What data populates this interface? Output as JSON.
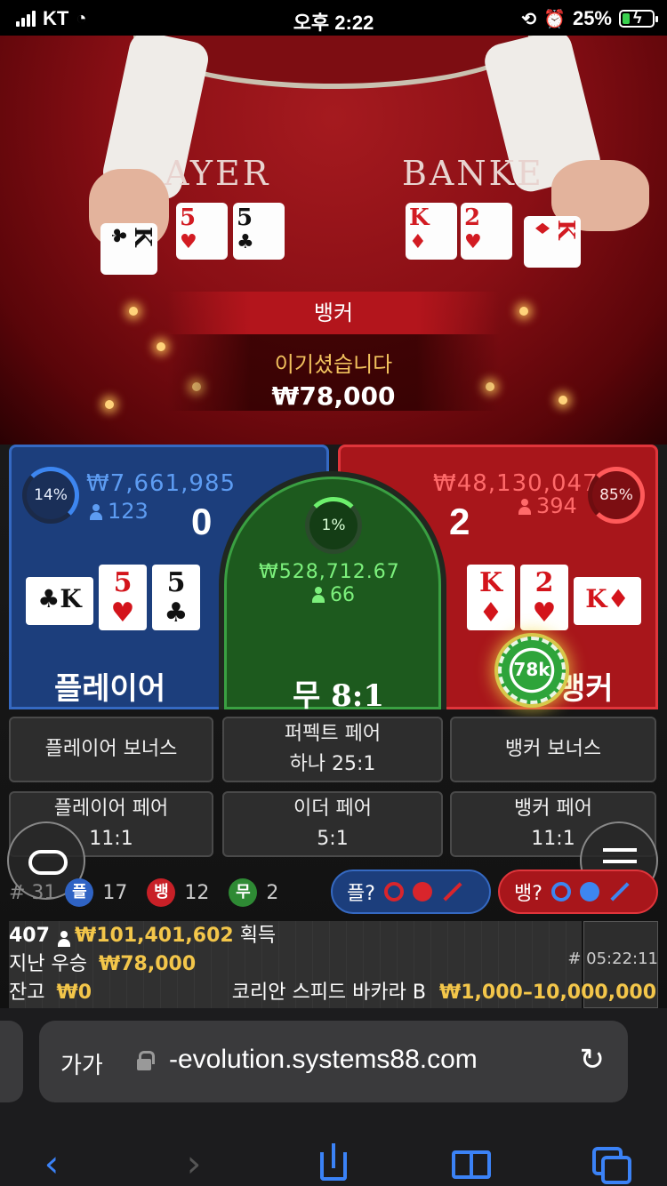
{
  "status_bar": {
    "carrier": "KT",
    "time": "오후 2:22",
    "battery": "25%"
  },
  "video": {
    "player_table_text": "AYER",
    "banker_table_text": "BANKE",
    "result_label": "뱅커",
    "win_message": "이기셨습니다",
    "win_amount": "₩78,000",
    "player_cards": [
      "K",
      "5",
      "5"
    ],
    "banker_cards": [
      "K",
      "2",
      "K"
    ]
  },
  "player": {
    "percent": "14%",
    "bet_total": "₩7,661,985",
    "players": "123",
    "score": "0",
    "label": "플레이어",
    "cards": [
      {
        "rank": "K",
        "suit": "♣",
        "color": "#111111"
      },
      {
        "rank": "5",
        "suit": "♥",
        "color": "#d3141b"
      },
      {
        "rank": "5",
        "suit": "♣",
        "color": "#111111"
      }
    ]
  },
  "tie": {
    "percent": "1%",
    "bet_total": "₩528,712.67",
    "players": "66",
    "label": "무",
    "payout": "8:1"
  },
  "banker": {
    "percent": "85%",
    "bet_total": "₩48,130,047",
    "players": "394",
    "score": "2",
    "label": "뱅커",
    "chip": "78k",
    "cards": [
      {
        "rank": "K",
        "suit": "♦",
        "color": "#d3141b"
      },
      {
        "rank": "2",
        "suit": "♥",
        "color": "#d3141b"
      },
      {
        "rank": "K",
        "suit": "♦",
        "color": "#d3141b"
      }
    ]
  },
  "side_bets": {
    "player_bonus": "플레이어 보너스",
    "perfect_pair": "퍼펙트 페어",
    "perfect_pair_payout": "하나 25:1",
    "banker_bonus": "뱅커 보너스",
    "player_pair": "플레이어 페어",
    "player_pair_payout": "11:1",
    "either_pair": "이더 페어",
    "either_pair_payout": "5:1",
    "banker_pair": "뱅커 페어",
    "banker_pair_payout": "11:1"
  },
  "stats": {
    "round_hash": "# 31",
    "player_badge": "플",
    "player_count": "17",
    "banker_badge": "뱅",
    "banker_count": "12",
    "tie_badge": "무",
    "tie_count": "2",
    "player_predict": "플?",
    "banker_predict": "뱅?"
  },
  "info": {
    "winners": "407",
    "total_won": "₩101,401,602",
    "won_label": "획득",
    "last_win_label": "지난 우승",
    "last_win": "₩78,000",
    "balance_label": "잔고",
    "balance": "₩0",
    "table_name": "코리안 스피드 바카라 B",
    "limits": "₩1,000–10,000,000",
    "game_id": "# 05:22:11"
  },
  "browser": {
    "aa": "가가",
    "host": "-evolution.systems88.com"
  },
  "colors": {
    "player": "#1c3e7c",
    "banker": "#a8161b",
    "tie": "#1d5a1e",
    "gold": "#f3c64a",
    "link": "#3b82f6"
  }
}
